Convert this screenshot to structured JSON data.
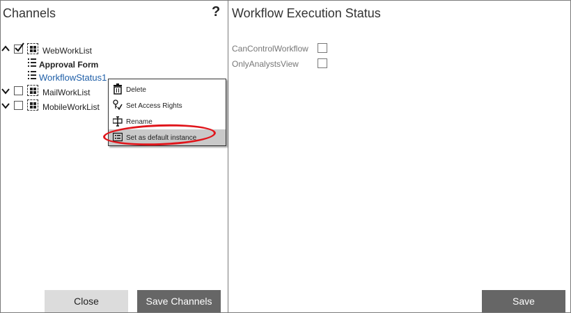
{
  "left_panel": {
    "title": "Channels",
    "help_label": "?"
  },
  "tree": [
    {
      "label": "WebWorkList",
      "expanded": true,
      "checked": true
    },
    {
      "label": "Approval Form",
      "bold": true
    },
    {
      "label": "WorkflowStatus1",
      "link_color": "#1f5fa8"
    },
    {
      "label": "MailWorkList",
      "expanded": false,
      "checked": false
    },
    {
      "label": "MobileWorkList",
      "expanded": false,
      "checked": false
    }
  ],
  "context_menu": {
    "items": [
      {
        "label": "Delete",
        "icon": "trash-icon"
      },
      {
        "label": "Set Access Rights",
        "icon": "key-check-icon"
      },
      {
        "label": "Rename",
        "icon": "rename-icon"
      },
      {
        "label": "Set as default instance",
        "icon": "list-icon",
        "highlighted": true
      }
    ]
  },
  "buttons": {
    "close": "Close",
    "save_channels": "Save Channels",
    "save": "Save"
  },
  "right_panel": {
    "title": "Workflow Execution Status",
    "properties": [
      {
        "label": "CanControlWorkflow",
        "checked": false
      },
      {
        "label": "OnlyAnalystsView",
        "checked": false
      }
    ]
  },
  "colors": {
    "highlight_ring": "#e0151b",
    "dark_button": "#666666",
    "light_button": "#dcdcdc"
  }
}
